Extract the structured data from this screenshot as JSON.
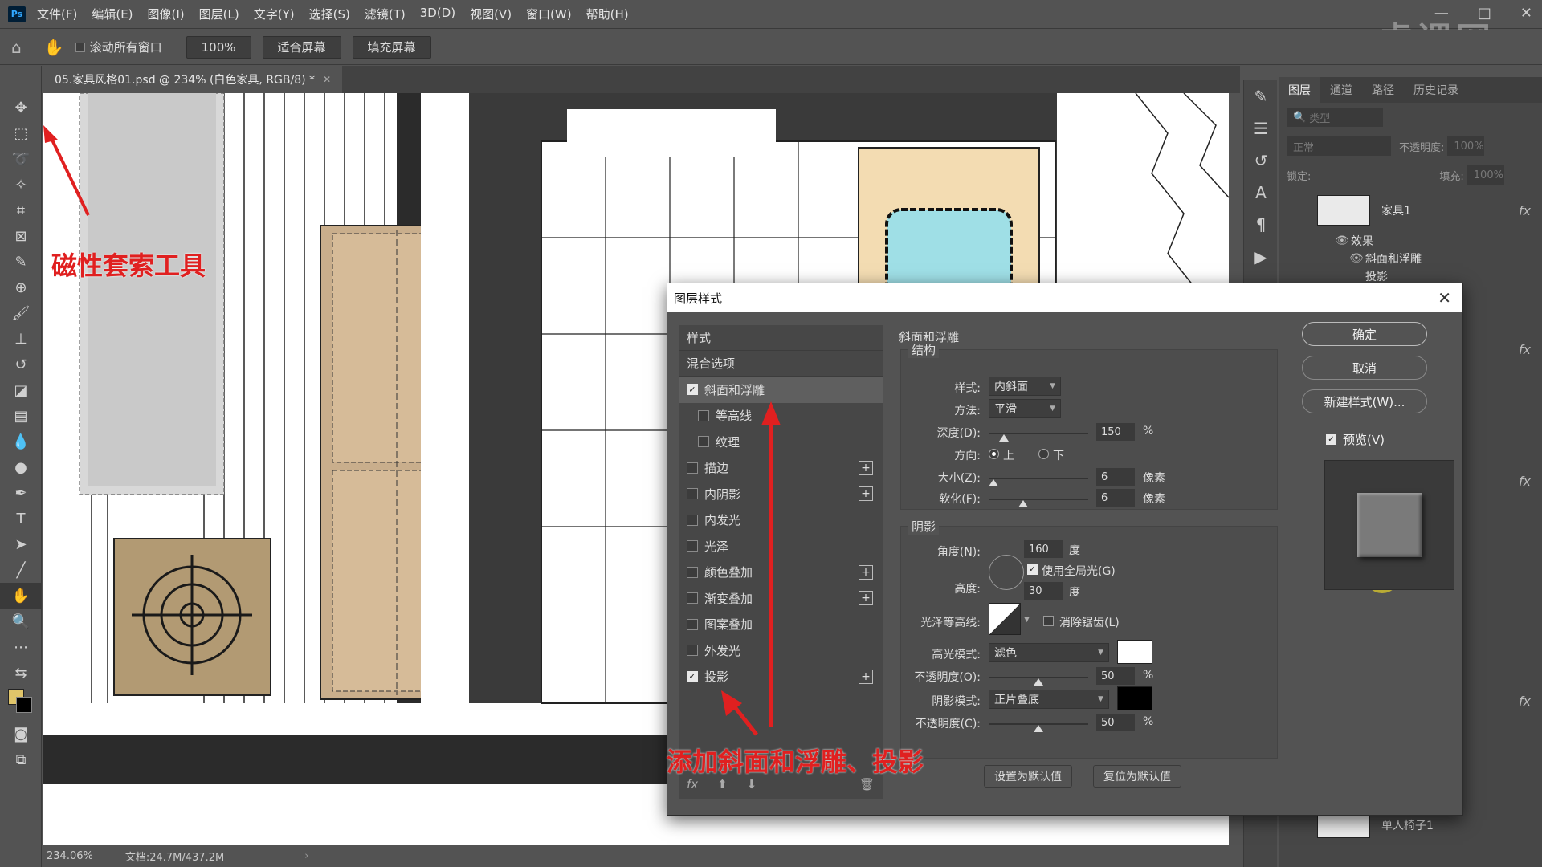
{
  "menubar": {
    "items": [
      "文件(F)",
      "编辑(E)",
      "图像(I)",
      "图层(L)",
      "文字(Y)",
      "选择(S)",
      "滤镜(T)",
      "3D(D)",
      "视图(V)",
      "窗口(W)",
      "帮助(H)"
    ],
    "logo": "Ps",
    "watermark": "虎课网"
  },
  "options": {
    "scroll_all_label": "滚动所有窗口",
    "zoom": "100%",
    "fit_screen": "适合屏幕",
    "fill_screen": "填充屏幕"
  },
  "document": {
    "tab_title": "05.家具风格01.psd @ 234% (白色家具, RGB/8) *",
    "status_zoom": "234.06%",
    "status_doc": "文档:24.7M/437.2M"
  },
  "annotations": {
    "lasso_tool": "磁性套索工具",
    "add_effects": "添加斜面和浮雕、投影"
  },
  "layers_panel": {
    "tabs": [
      "图层",
      "通道",
      "路径",
      "历史记录"
    ],
    "search_placeholder": "类型",
    "blend_mode": "正常",
    "opacity_label": "不透明度:",
    "opacity_value": "100%",
    "lock_label": "锁定:",
    "fill_label": "填充:",
    "fill_value": "100%",
    "layer_name": "家具1",
    "effects_label": "效果",
    "effect_bevel": "斜面和浮雕",
    "effect_shadow": "投影",
    "bottom_layer": "单人椅子1",
    "fx": "fx"
  },
  "dialog": {
    "title": "图层样式",
    "style_header": "样式",
    "blend_options": "混合选项",
    "styles": [
      {
        "label": "斜面和浮雕",
        "checked": true,
        "selected": true,
        "indent": false,
        "plus": false
      },
      {
        "label": "等高线",
        "checked": false,
        "selected": false,
        "indent": true,
        "plus": false
      },
      {
        "label": "纹理",
        "checked": false,
        "selected": false,
        "indent": true,
        "plus": false
      },
      {
        "label": "描边",
        "checked": false,
        "selected": false,
        "indent": false,
        "plus": true
      },
      {
        "label": "内阴影",
        "checked": false,
        "selected": false,
        "indent": false,
        "plus": true
      },
      {
        "label": "内发光",
        "checked": false,
        "selected": false,
        "indent": false,
        "plus": false
      },
      {
        "label": "光泽",
        "checked": false,
        "selected": false,
        "indent": false,
        "plus": false
      },
      {
        "label": "颜色叠加",
        "checked": false,
        "selected": false,
        "indent": false,
        "plus": true
      },
      {
        "label": "渐变叠加",
        "checked": false,
        "selected": false,
        "indent": false,
        "plus": true
      },
      {
        "label": "图案叠加",
        "checked": false,
        "selected": false,
        "indent": false,
        "plus": false
      },
      {
        "label": "外发光",
        "checked": false,
        "selected": false,
        "indent": false,
        "plus": false
      },
      {
        "label": "投影",
        "checked": true,
        "selected": false,
        "indent": false,
        "plus": true
      }
    ],
    "footer_fx": "fx",
    "section_title": "斜面和浮雕",
    "structure_title": "结构",
    "style_label": "样式:",
    "style_value": "内斜面",
    "technique_label": "方法:",
    "technique_value": "平滑",
    "depth_label": "深度(D):",
    "depth_value": "150",
    "depth_pct": 0.15,
    "percent": "%",
    "direction_label": "方向:",
    "dir_up": "上",
    "dir_down": "下",
    "size_label": "大小(Z):",
    "size_value": "6",
    "size_pct": 0.05,
    "soften_label": "软化(F):",
    "soften_value": "6",
    "soften_pct": 0.35,
    "px_unit": "像素",
    "shading_title": "阴影",
    "angle_label": "角度(N):",
    "angle_value": "160",
    "degree": "度",
    "global_light": "使用全局光(G)",
    "altitude_label": "高度:",
    "altitude_value": "30",
    "gloss_label": "光泽等高线:",
    "antialias": "消除锯齿(L)",
    "highlight_label": "高光模式:",
    "highlight_value": "滤色",
    "highlight_color": "#ffffff",
    "hl_opacity_label": "不透明度(O):",
    "hl_opacity_value": "50",
    "hl_opacity_pct": 0.5,
    "shadow_label": "阴影模式:",
    "shadow_value": "正片叠底",
    "shadow_color": "#000000",
    "sh_opacity_label": "不透明度(C):",
    "sh_opacity_value": "50",
    "sh_opacity_pct": 0.5,
    "make_default": "设置为默认值",
    "reset_default": "复位为默认值",
    "ok": "确定",
    "cancel": "取消",
    "new_style": "新建样式(W)...",
    "preview": "预览(V)"
  }
}
